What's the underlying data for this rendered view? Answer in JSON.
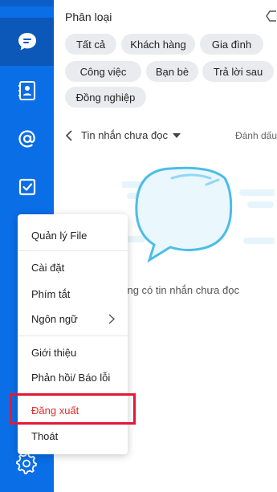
{
  "sidebar": {
    "items": [
      {
        "icon": "chat-icon",
        "active": true
      },
      {
        "icon": "contacts-icon",
        "active": false
      },
      {
        "icon": "at-mention-icon",
        "active": false
      },
      {
        "icon": "todo-check-icon",
        "active": false
      }
    ],
    "settings_icon": "gear-icon"
  },
  "classification": {
    "title": "Phân loại",
    "chips": [
      "Tất cả",
      "Khách hàng",
      "Gia đình",
      "Công việc",
      "Bạn bè",
      "Trả lời sau",
      "Đồng nghiệp"
    ]
  },
  "filter": {
    "label": "Tin nhắn chưa đọc",
    "mark_read": "Đánh dấu"
  },
  "empty_state": {
    "text": "hông có tin nhắn chưa đọc"
  },
  "menu": {
    "items": [
      {
        "label": "Quản lý File"
      },
      {
        "label": "Cài đặt"
      },
      {
        "label": "Phím tắt"
      },
      {
        "label": "Ngôn ngữ"
      },
      {
        "label": "Giới thiệu"
      },
      {
        "label": "Phản hồi/ Báo lỗi"
      },
      {
        "label": "Đăng xuất"
      },
      {
        "label": "Thoát"
      }
    ]
  },
  "colors": {
    "rail": "#0a6ee6",
    "rail_active": "#0b58b8",
    "logout_text": "#e02b2b",
    "highlight_border": "#e31837",
    "bubble": "#5bc3ea"
  }
}
